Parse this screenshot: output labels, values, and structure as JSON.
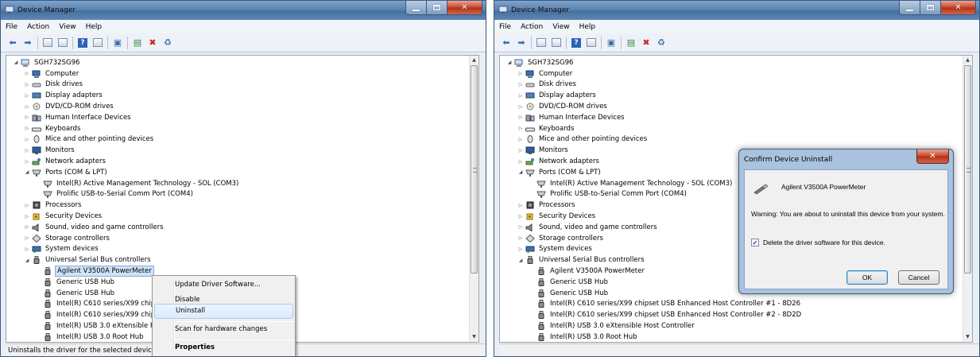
{
  "window_title": "Device Manager",
  "menu": [
    "File",
    "Action",
    "View",
    "Help"
  ],
  "tree": [
    {
      "level": 0,
      "exp": "open",
      "icon": "computer-root-icon",
      "label": "SGH732SG96"
    },
    {
      "level": 1,
      "exp": "closed",
      "icon": "computer-icon",
      "label": "Computer"
    },
    {
      "level": 1,
      "exp": "closed",
      "icon": "disk-drive-icon",
      "label": "Disk drives"
    },
    {
      "level": 1,
      "exp": "closed",
      "icon": "display-adapter-icon",
      "label": "Display adapters"
    },
    {
      "level": 1,
      "exp": "closed",
      "icon": "dvd-drive-icon",
      "label": "DVD/CD-ROM drives"
    },
    {
      "level": 1,
      "exp": "closed",
      "icon": "hid-icon",
      "label": "Human Interface Devices"
    },
    {
      "level": 1,
      "exp": "closed",
      "icon": "keyboard-icon",
      "label": "Keyboards"
    },
    {
      "level": 1,
      "exp": "closed",
      "icon": "mouse-icon",
      "label": "Mice and other pointing devices"
    },
    {
      "level": 1,
      "exp": "closed",
      "icon": "monitor-icon",
      "label": "Monitors"
    },
    {
      "level": 1,
      "exp": "closed",
      "icon": "network-adapter-icon",
      "label": "Network adapters"
    },
    {
      "level": 1,
      "exp": "open",
      "icon": "port-icon",
      "label": "Ports (COM & LPT)"
    },
    {
      "level": 2,
      "exp": "none",
      "icon": "port-icon",
      "label": "Intel(R) Active Management Technology - SOL (COM3)"
    },
    {
      "level": 2,
      "exp": "none",
      "icon": "port-icon",
      "label": "Prolific USB-to-Serial Comm Port (COM4)"
    },
    {
      "level": 1,
      "exp": "closed",
      "icon": "processor-icon",
      "label": "Processors"
    },
    {
      "level": 1,
      "exp": "closed",
      "icon": "security-device-icon",
      "label": "Security Devices"
    },
    {
      "level": 1,
      "exp": "closed",
      "icon": "sound-icon",
      "label": "Sound, video and game controllers"
    },
    {
      "level": 1,
      "exp": "closed",
      "icon": "storage-controller-icon",
      "label": "Storage controllers"
    },
    {
      "level": 1,
      "exp": "closed",
      "icon": "system-device-icon",
      "label": "System devices"
    },
    {
      "level": 1,
      "exp": "open",
      "icon": "usb-icon",
      "label": "Universal Serial Bus controllers"
    },
    {
      "level": 2,
      "exp": "none",
      "icon": "usb-icon",
      "label": "Agilent V3500A PowerMeter"
    },
    {
      "level": 2,
      "exp": "none",
      "icon": "usb-icon",
      "label": "Generic USB Hub"
    },
    {
      "level": 2,
      "exp": "none",
      "icon": "usb-icon",
      "label": "Generic USB Hub"
    },
    {
      "level": 2,
      "exp": "none",
      "icon": "usb-icon",
      "label": "Intel(R) C610 series/X99 chipset USB Enhanced Host Controller #1 - 8D26"
    },
    {
      "level": 2,
      "exp": "none",
      "icon": "usb-icon",
      "label": "Intel(R) C610 series/X99 chipset USB Enhanced Host Controller #2 - 8D2D"
    },
    {
      "level": 2,
      "exp": "none",
      "icon": "usb-icon",
      "label": "Intel(R) USB 3.0 eXtensible Host Controller"
    },
    {
      "level": 2,
      "exp": "none",
      "icon": "usb-icon",
      "label": "Intel(R) USB 3.0 Root Hub"
    }
  ],
  "left_tree_labels_truncated": {
    "22": "Intel(R) C610 series/X99 chip",
    "23": "Intel(R) C610 series/X99 chip",
    "24": "Intel(R) USB 3.0 eXtensible H",
    "25": "Intel(R) USB 3.0 Root Hub"
  },
  "selected_row": 19,
  "context_menu": {
    "items": [
      {
        "label": "Update Driver Software...",
        "bold": false,
        "highlight": false
      },
      {
        "label": "Disable",
        "bold": false,
        "highlight": false
      },
      {
        "label": "Uninstall",
        "bold": false,
        "highlight": true
      },
      {
        "separator": true
      },
      {
        "label": "Scan for hardware changes",
        "bold": false,
        "highlight": false
      },
      {
        "separator": true
      },
      {
        "label": "Properties",
        "bold": true,
        "highlight": false
      }
    ]
  },
  "status_text": "Uninstalls the driver for the selected device.",
  "dialog": {
    "title": "Confirm Device Uninstall",
    "device_name": "Agilent V3500A PowerMeter",
    "warning": "Warning: You are about to uninstall this device from your system.",
    "checkbox_label": "Delete the driver software for this device.",
    "checkbox_checked": true,
    "ok_label": "OK",
    "cancel_label": "Cancel"
  },
  "colors": {
    "titlebar": "#5c84b3",
    "selection": "#cde4f7",
    "close_button": "#c6452c"
  }
}
